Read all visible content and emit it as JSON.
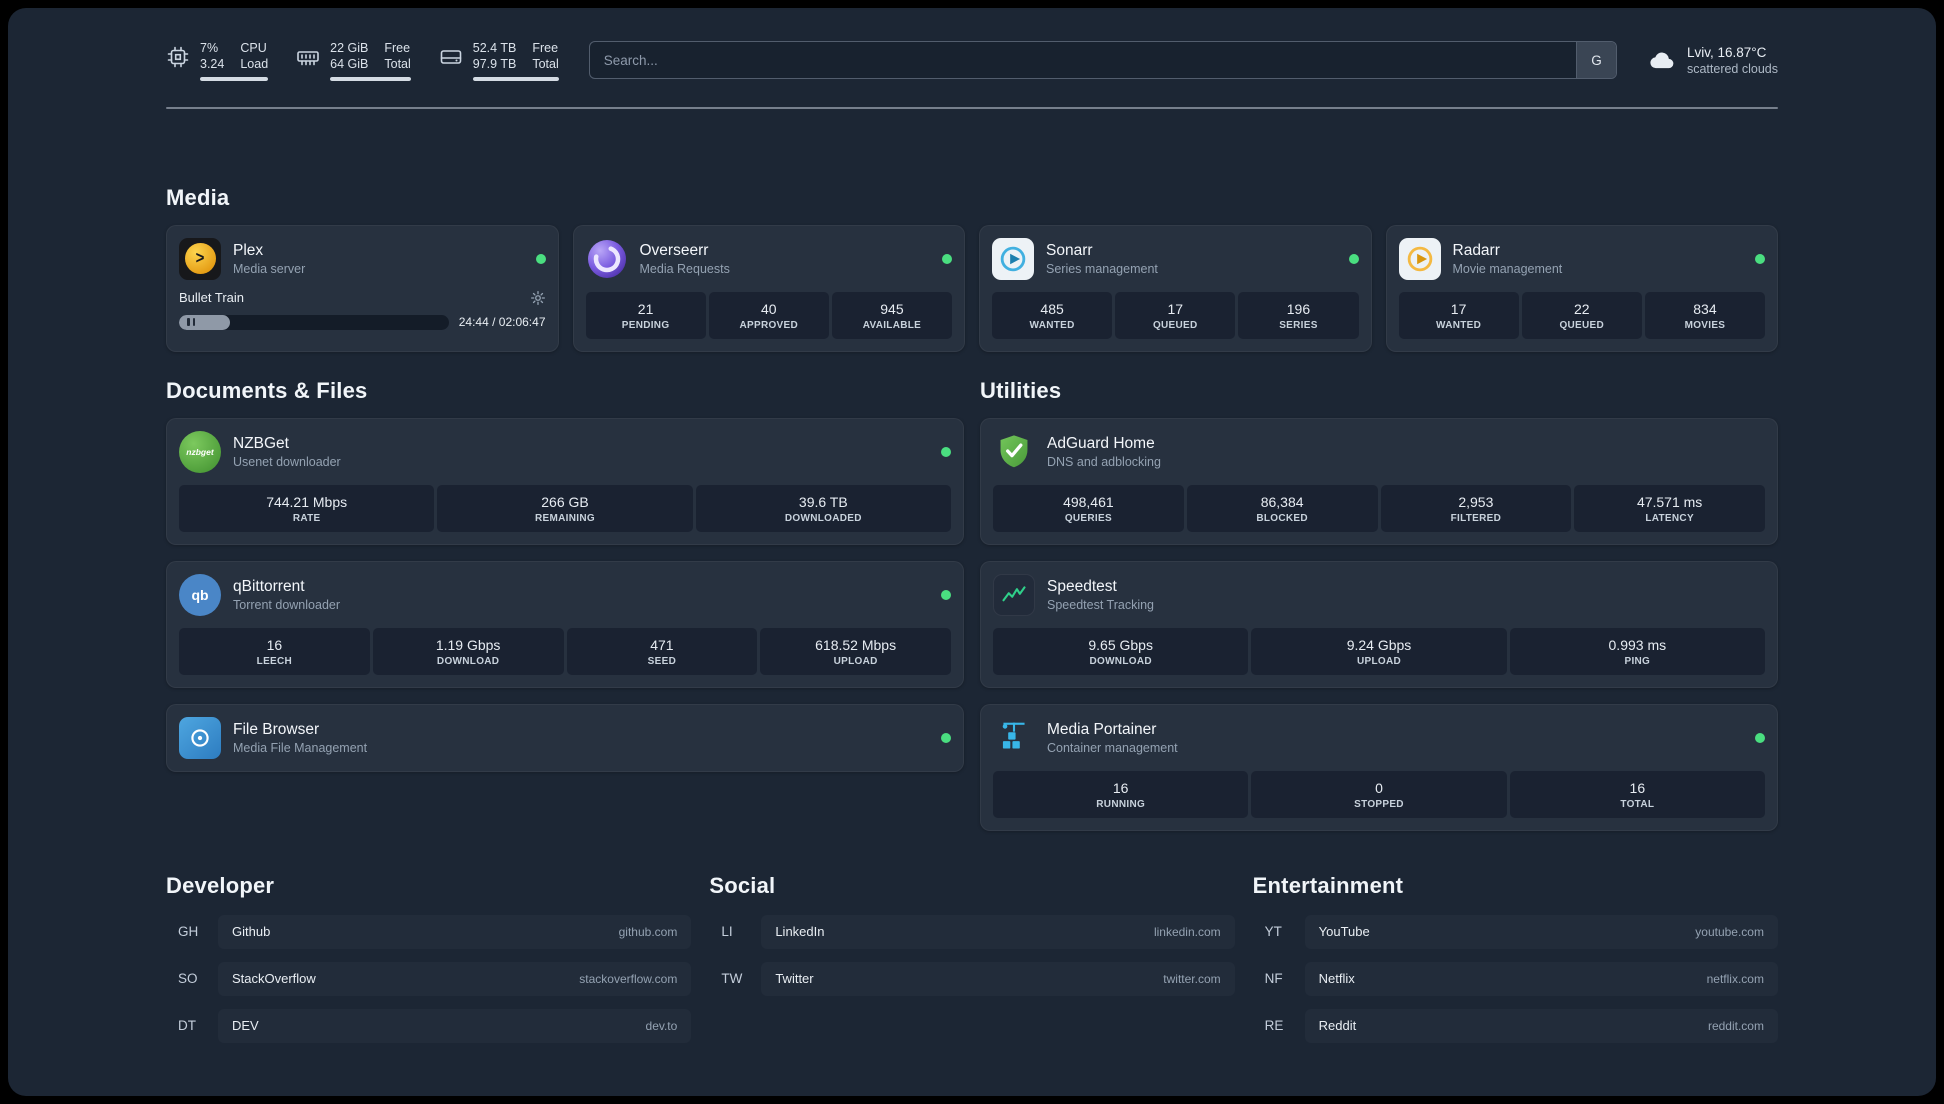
{
  "topbar": {
    "resources": [
      {
        "icon": "cpu-icon",
        "primary": "7%",
        "secondary": "3.24",
        "label_primary": "CPU",
        "label_secondary": "Load",
        "bar_percent": 100
      },
      {
        "icon": "memory-icon",
        "primary": "22 GiB",
        "secondary": "64 GiB",
        "label_primary": "Free",
        "label_secondary": "Total",
        "bar_percent": 100
      },
      {
        "icon": "disk-icon",
        "primary": "52.4 TB",
        "secondary": "97.9 TB",
        "label_primary": "Free",
        "label_secondary": "Total",
        "bar_percent": 100
      }
    ],
    "search": {
      "placeholder": "Search...",
      "button": "G"
    },
    "weather": {
      "icon": "cloud-icon",
      "location": "Lviv, 16.87°C",
      "condition": "scattered clouds"
    }
  },
  "media": {
    "title": "Media",
    "cards": [
      {
        "name": "Plex",
        "subtitle": "Media server",
        "icon": "plex-icon",
        "status": "online",
        "now_playing": {
          "title": "Bullet Train",
          "time_display": "24:44 / 02:06:47",
          "progress_percent": 19
        }
      },
      {
        "name": "Overseerr",
        "subtitle": "Media Requests",
        "icon": "overseerr-icon",
        "status": "online",
        "stats": [
          {
            "value": "21",
            "label": "PENDING"
          },
          {
            "value": "40",
            "label": "APPROVED"
          },
          {
            "value": "945",
            "label": "AVAILABLE"
          }
        ]
      },
      {
        "name": "Sonarr",
        "subtitle": "Series management",
        "icon": "sonarr-icon",
        "status": "online",
        "stats": [
          {
            "value": "485",
            "label": "WANTED"
          },
          {
            "value": "17",
            "label": "QUEUED"
          },
          {
            "value": "196",
            "label": "SERIES"
          }
        ]
      },
      {
        "name": "Radarr",
        "subtitle": "Movie management",
        "icon": "radarr-icon",
        "status": "online",
        "stats": [
          {
            "value": "17",
            "label": "WANTED"
          },
          {
            "value": "22",
            "label": "QUEUED"
          },
          {
            "value": "834",
            "label": "MOVIES"
          }
        ]
      }
    ]
  },
  "documents": {
    "title": "Documents & Files",
    "cards": [
      {
        "name": "NZBGet",
        "subtitle": "Usenet downloader",
        "icon": "nzbget-icon",
        "icon_text": "nzbget",
        "status": "online",
        "stats": [
          {
            "value": "744.21 Mbps",
            "label": "RATE"
          },
          {
            "value": "266 GB",
            "label": "REMAINING"
          },
          {
            "value": "39.6 TB",
            "label": "DOWNLOADED"
          }
        ]
      },
      {
        "name": "qBittorrent",
        "subtitle": "Torrent downloader",
        "icon": "qbittorrent-icon",
        "icon_text": "qb",
        "status": "online",
        "stats": [
          {
            "value": "16",
            "label": "LEECH"
          },
          {
            "value": "1.19 Gbps",
            "label": "DOWNLOAD"
          },
          {
            "value": "471",
            "label": "SEED"
          },
          {
            "value": "618.52 Mbps",
            "label": "UPLOAD"
          }
        ]
      },
      {
        "name": "File Browser",
        "subtitle": "Media File Management",
        "icon": "filebrowser-icon",
        "status": "online"
      }
    ]
  },
  "utilities": {
    "title": "Utilities",
    "cards": [
      {
        "name": "AdGuard Home",
        "subtitle": "DNS and adblocking",
        "icon": "adguard-icon",
        "stats": [
          {
            "value": "498,461",
            "label": "QUERIES"
          },
          {
            "value": "86,384",
            "label": "BLOCKED"
          },
          {
            "value": "2,953",
            "label": "FILTERED"
          },
          {
            "value": "47.571 ms",
            "label": "LATENCY"
          }
        ]
      },
      {
        "name": "Speedtest",
        "subtitle": "Speedtest Tracking",
        "icon": "speedtest-icon",
        "stats": [
          {
            "value": "9.65 Gbps",
            "label": "DOWNLOAD"
          },
          {
            "value": "9.24 Gbps",
            "label": "UPLOAD"
          },
          {
            "value": "0.993 ms",
            "label": "PING"
          }
        ]
      },
      {
        "name": "Media Portainer",
        "subtitle": "Container management",
        "icon": "portainer-icon",
        "status": "online",
        "stats": [
          {
            "value": "16",
            "label": "RUNNING"
          },
          {
            "value": "0",
            "label": "STOPPED"
          },
          {
            "value": "16",
            "label": "TOTAL"
          }
        ]
      }
    ]
  },
  "bookmarks": [
    {
      "title": "Developer",
      "items": [
        {
          "abbr": "GH",
          "name": "Github",
          "domain": "github.com"
        },
        {
          "abbr": "SO",
          "name": "StackOverflow",
          "domain": "stackoverflow.com"
        },
        {
          "abbr": "DT",
          "name": "DEV",
          "domain": "dev.to"
        }
      ]
    },
    {
      "title": "Social",
      "items": [
        {
          "abbr": "LI",
          "name": "LinkedIn",
          "domain": "linkedin.com"
        },
        {
          "abbr": "TW",
          "name": "Twitter",
          "domain": "twitter.com"
        }
      ]
    },
    {
      "title": "Entertainment",
      "items": [
        {
          "abbr": "YT",
          "name": "YouTube",
          "domain": "youtube.com"
        },
        {
          "abbr": "NF",
          "name": "Netflix",
          "domain": "netflix.com"
        },
        {
          "abbr": "RE",
          "name": "Reddit",
          "domain": "reddit.com"
        }
      ]
    }
  ],
  "colors": {
    "status_online": "#4ade80",
    "background": "#1c2634",
    "card": "#27313f"
  }
}
